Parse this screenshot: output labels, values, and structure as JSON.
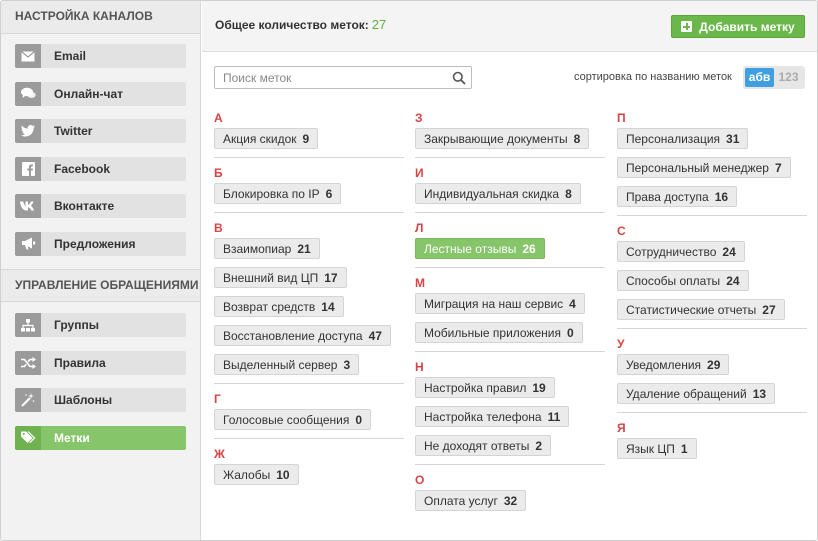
{
  "sidebar": {
    "section1": "НАСТРОЙКА КАНАЛОВ",
    "channels": [
      {
        "label": "Email",
        "icon": "envelope-icon"
      },
      {
        "label": "Онлайн-чат",
        "icon": "chat-bubbles-icon"
      },
      {
        "label": "Twitter",
        "icon": "twitter-bird-icon"
      },
      {
        "label": "Facebook",
        "icon": "facebook-icon"
      },
      {
        "label": "Вконтакте",
        "icon": "vk-icon"
      },
      {
        "label": "Предложения",
        "icon": "megaphone-icon"
      }
    ],
    "section2": "УПРАВЛЕНИЕ ОБРАЩЕНИЯМИ",
    "management": [
      {
        "label": "Группы",
        "icon": "hierarchy-icon"
      },
      {
        "label": "Правила",
        "icon": "shuffle-icon"
      },
      {
        "label": "Шаблоны",
        "icon": "magic-wand-icon"
      },
      {
        "label": "Метки",
        "icon": "tags-icon",
        "active": true
      }
    ]
  },
  "header": {
    "total_label": "Общее количество меток:",
    "total_count": "27",
    "add_button": "Добавить метку"
  },
  "toolbar": {
    "search_placeholder": "Поиск меток",
    "sort_label": "сортировка по названию меток",
    "sort_alpha": "абв",
    "sort_num": "123"
  },
  "columns": [
    [
      {
        "letter": "А",
        "tags": [
          {
            "name": "Акция скидок",
            "count": "9"
          }
        ]
      },
      {
        "letter": "Б",
        "tags": [
          {
            "name": "Блокировка по IP",
            "count": "6"
          }
        ]
      },
      {
        "letter": "В",
        "tags": [
          {
            "name": "Взаимопиар",
            "count": "21"
          },
          {
            "name": "Внешний вид ЦП",
            "count": "17"
          },
          {
            "name": "Возврат средств",
            "count": "14"
          },
          {
            "name": "Восстановление доступа",
            "count": "47"
          },
          {
            "name": "Выделенный сервер",
            "count": "3"
          }
        ]
      },
      {
        "letter": "Г",
        "tags": [
          {
            "name": "Голосовые сообщения",
            "count": "0"
          }
        ]
      },
      {
        "letter": "Ж",
        "tags": [
          {
            "name": "Жалобы",
            "count": "10"
          }
        ]
      }
    ],
    [
      {
        "letter": "З",
        "tags": [
          {
            "name": "Закрывающие документы",
            "count": "8"
          }
        ]
      },
      {
        "letter": "И",
        "tags": [
          {
            "name": "Индивидуальная скидка",
            "count": "8"
          }
        ]
      },
      {
        "letter": "Л",
        "tags": [
          {
            "name": "Лестные отзывы",
            "count": "26",
            "highlight": true
          }
        ]
      },
      {
        "letter": "М",
        "tags": [
          {
            "name": "Миграция на наш сервис",
            "count": "4"
          },
          {
            "name": "Мобильные приложения",
            "count": "0"
          }
        ]
      },
      {
        "letter": "Н",
        "tags": [
          {
            "name": "Настройка правил",
            "count": "19"
          },
          {
            "name": "Настройка телефона",
            "count": "11"
          },
          {
            "name": "Не доходят ответы",
            "count": "2"
          }
        ]
      },
      {
        "letter": "О",
        "tags": [
          {
            "name": "Оплата услуг",
            "count": "32"
          }
        ]
      }
    ],
    [
      {
        "letter": "П",
        "tags": [
          {
            "name": "Персонализация",
            "count": "31"
          },
          {
            "name": "Персональный менеджер",
            "count": "7"
          },
          {
            "name": "Права доступа",
            "count": "16"
          }
        ]
      },
      {
        "letter": "С",
        "tags": [
          {
            "name": "Сотрудничество",
            "count": "24"
          },
          {
            "name": "Способы оплаты",
            "count": "24"
          },
          {
            "name": "Статистические отчеты",
            "count": "27"
          }
        ]
      },
      {
        "letter": "У",
        "tags": [
          {
            "name": "Уведомления",
            "count": "29"
          },
          {
            "name": "Удаление обращений",
            "count": "13"
          }
        ]
      },
      {
        "letter": "Я",
        "tags": [
          {
            "name": "Язык ЦП",
            "count": "1"
          }
        ]
      }
    ]
  ],
  "colors": {
    "accent_green": "#6bb84a",
    "letter_red": "#d94343",
    "sort_blue": "#3f9fe0"
  }
}
